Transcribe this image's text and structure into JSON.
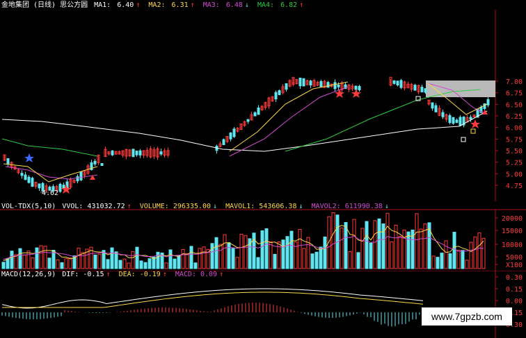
{
  "colors": {
    "up": "#ff3b3b",
    "down": "#5fe6f0",
    "ma1": "#ffffff",
    "ma2": "#ffd84a",
    "ma3": "#d24bd2",
    "ma4": "#2ecc40",
    "axis": "#b0101a",
    "bg": "#000000"
  },
  "price_header": {
    "title": "金地集团 (日线)  思公方圆",
    "ma1_label": "MA1:",
    "ma1_val": "6.40",
    "ma1_arrow": "↑",
    "ma2_label": "MA2:",
    "ma2_val": "6.31",
    "ma2_arrow": "↑",
    "ma3_label": "MA3:",
    "ma3_val": "6.48",
    "ma3_arrow": "↓",
    "ma4_label": "MA4:",
    "ma4_val": "6.82",
    "ma4_arrow": "↑"
  },
  "vol_header": {
    "name": "VOL-TDX(5,10)",
    "vvol": "VVOL: 431032.72",
    "vvol_arrow": "↑",
    "volume": "VOLUME: 296335.00",
    "volume_arrow": "↓",
    "mavol1": "MAVOL1: 543606.38",
    "mavol1_arrow": "↓",
    "mavol2": "MAVOL2: 611990.38",
    "mavol2_arrow": "↓"
  },
  "macd_header": {
    "name": "MACD(12,26,9)",
    "dif": "DIF: -0.15",
    "dif_arrow": "↑",
    "dea": "DEA: -0.19",
    "dea_arrow": "↑",
    "macd": "MACD: 0.09",
    "macd_arrow": "↑"
  },
  "low_label": "4.62",
  "watermark": "www.7gpzb.com",
  "chart_data": [
    {
      "type": "candlestick",
      "title": "金地集团 (日线)",
      "y_ticks": [
        "7.00",
        "6.75",
        "6.50",
        "6.25",
        "6.00",
        "5.75",
        "5.50",
        "5.25",
        "5.00",
        "4.75"
      ],
      "ylim": [
        4.62,
        7.0
      ],
      "annotations": [
        "4.62"
      ]
    },
    {
      "type": "bar",
      "title": "VOL-TDX(5,10)",
      "y_ticks": [
        "20000",
        "15000",
        "10000",
        "5000",
        "X100"
      ]
    },
    {
      "type": "bar",
      "title": "MACD(12,26,9)",
      "y_ticks": [
        "0.30",
        "0.15",
        "0.00",
        "-0.15",
        "-0.30"
      ]
    }
  ]
}
